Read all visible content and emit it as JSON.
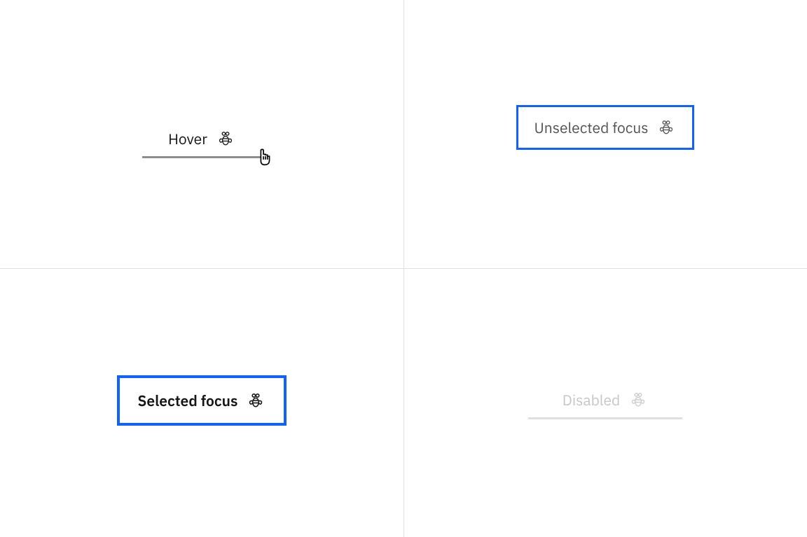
{
  "tabs": {
    "hover": {
      "label": "Hover"
    },
    "unselected_focus": {
      "label": "Unselected focus"
    },
    "selected_focus": {
      "label": "Selected focus"
    },
    "disabled": {
      "label": "Disabled"
    }
  },
  "colors": {
    "focus_ring": "#0f62fe",
    "text_primary": "#161616",
    "text_secondary": "#525252",
    "text_disabled": "#c6c6c6",
    "border_hover": "#8d8d8d",
    "border_disabled": "#e0e0e0"
  }
}
